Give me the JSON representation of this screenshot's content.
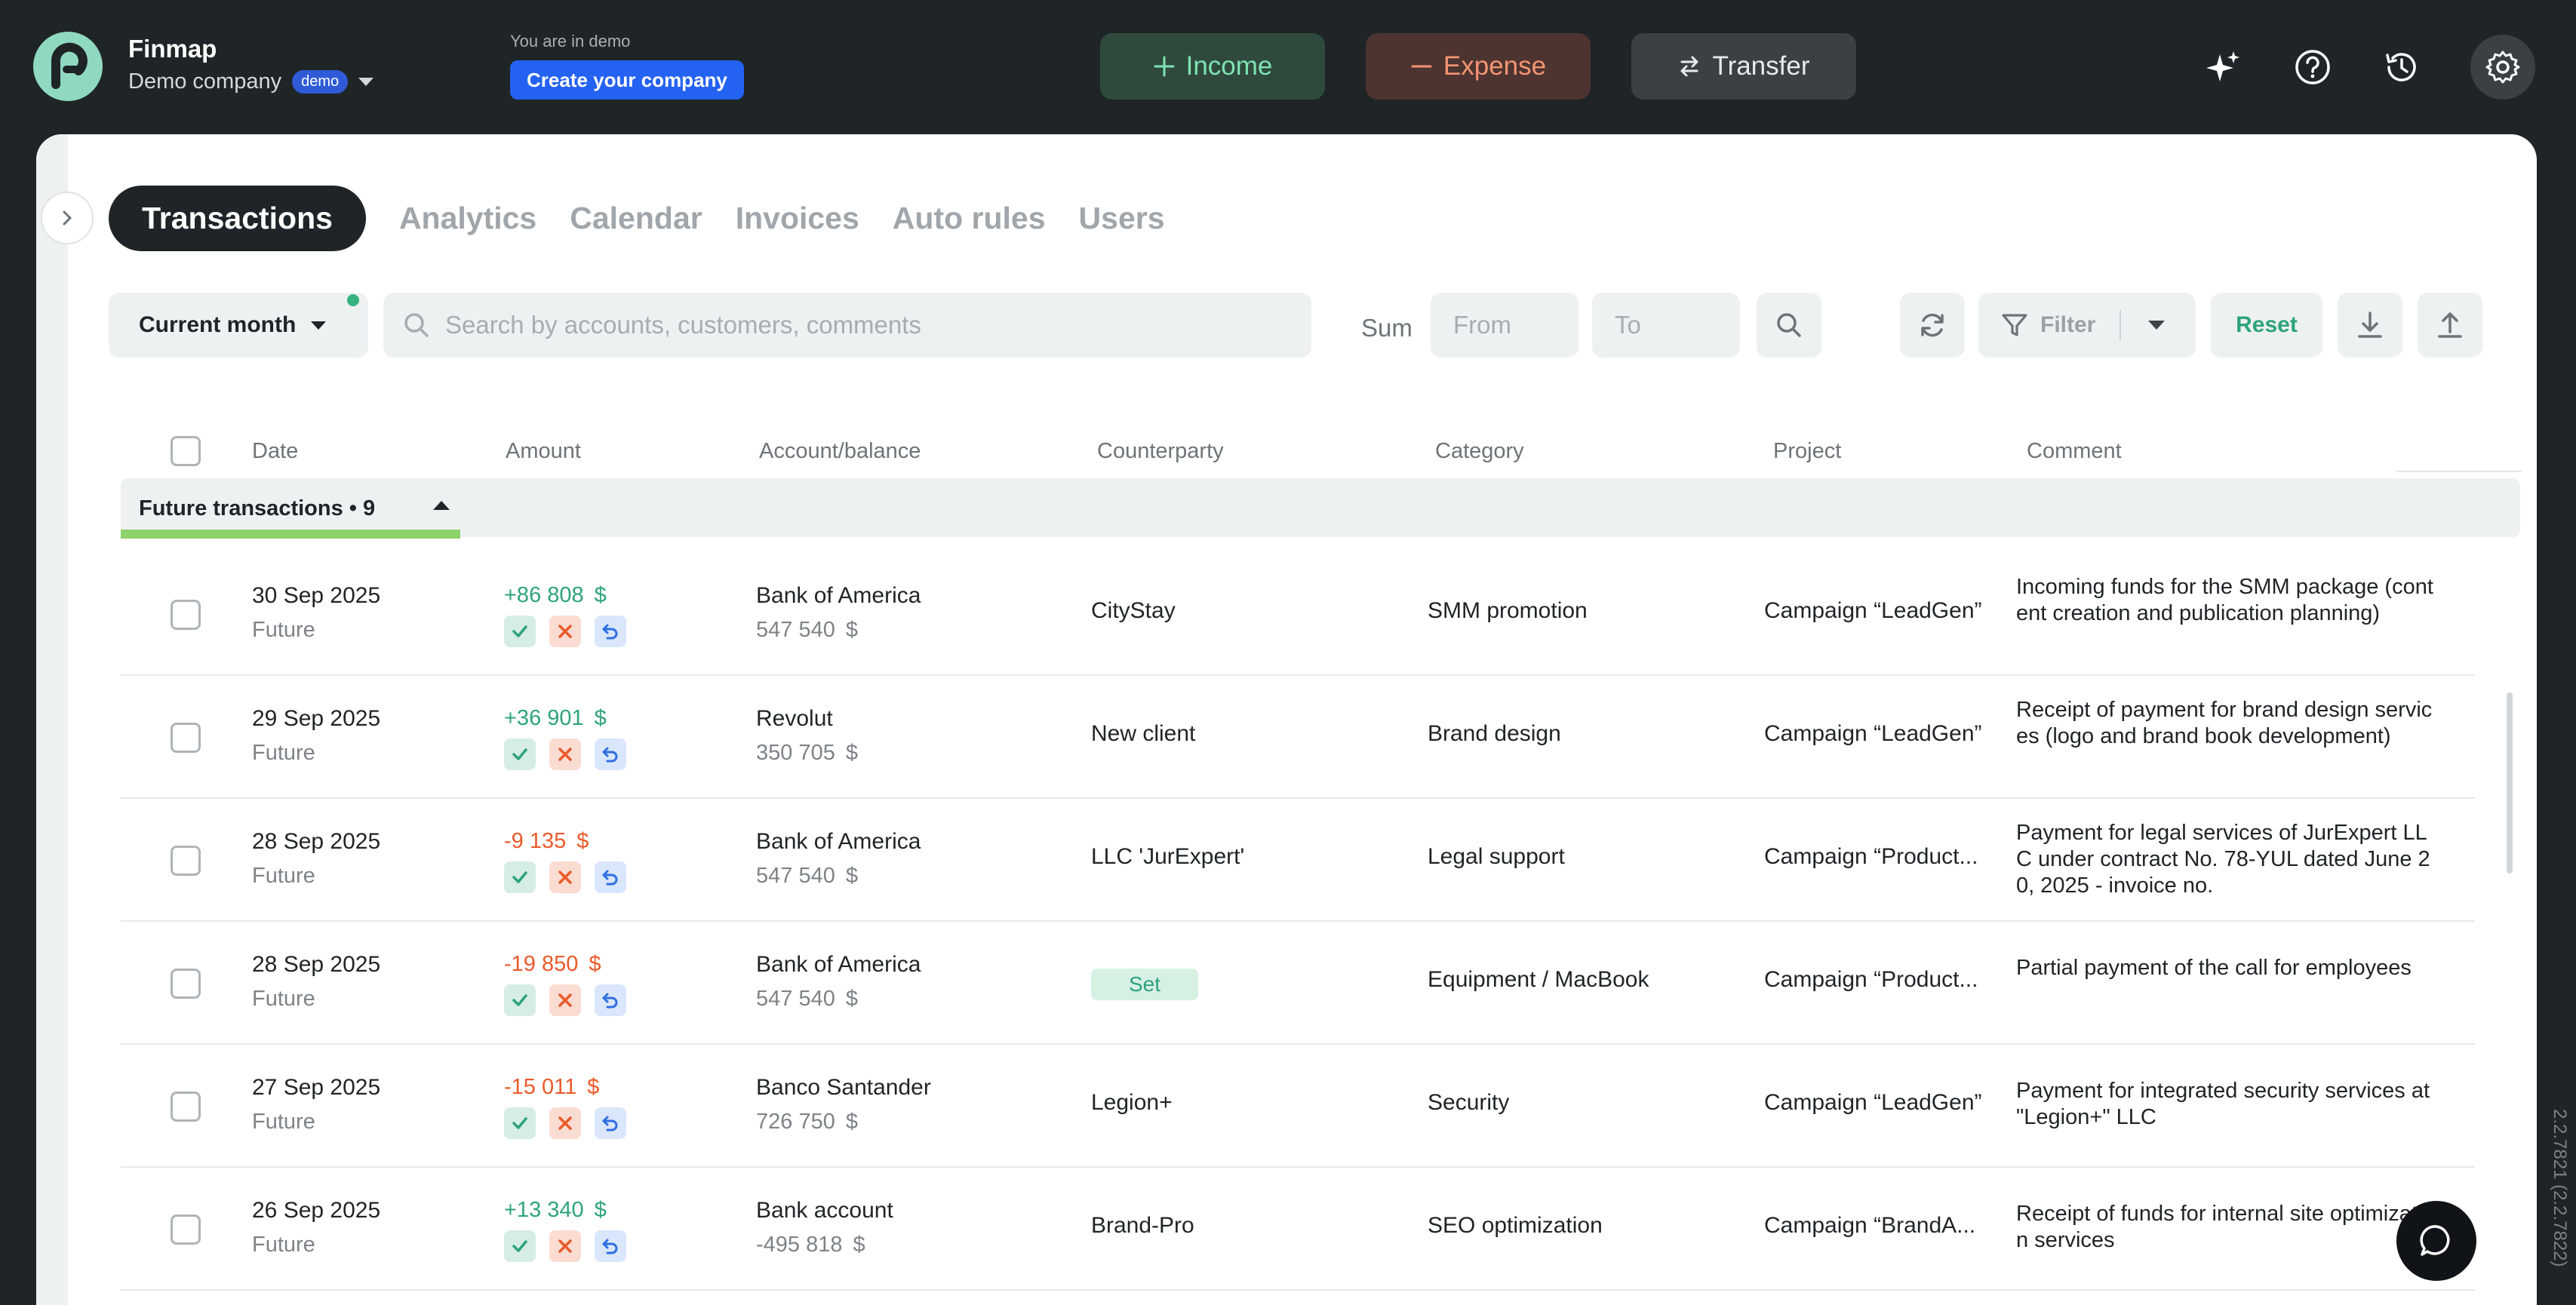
{
  "app": {
    "brand": "Finmap",
    "company": "Demo company",
    "badge": "demo",
    "demo_note": "You are in demo",
    "create_company": "Create your company"
  },
  "top_actions": {
    "income": "Income",
    "expense": "Expense",
    "transfer": "Transfer"
  },
  "top_icons": [
    "sparkles-icon",
    "help-icon",
    "history-icon",
    "settings-icon"
  ],
  "tabs": [
    "Transactions",
    "Analytics",
    "Calendar",
    "Invoices",
    "Auto rules",
    "Users"
  ],
  "filters": {
    "period": "Current month",
    "search_placeholder": "Search by accounts, customers, comments",
    "sum_label": "Sum",
    "from_placeholder": "From",
    "to_placeholder": "To",
    "filter_label": "Filter",
    "reset_label": "Reset"
  },
  "table": {
    "headers": {
      "date": "Date",
      "amount": "Amount",
      "account": "Account/balance",
      "counterparty": "Counterparty",
      "category": "Category",
      "project": "Project",
      "comment": "Comment"
    },
    "group_label": "Future transactions • 9",
    "rows": [
      {
        "date": "30 Sep 2025",
        "status": "Future",
        "amount": "+86 808",
        "currency": "$",
        "account": "Bank of America",
        "balance": "547 540",
        "counterparty": "CityStay",
        "category": "SMM promotion",
        "project": "Campaign “LeadGen”",
        "comment": "Incoming funds for the SMM package (content creation and publication planning)"
      },
      {
        "date": "29 Sep 2025",
        "status": "Future",
        "amount": "+36 901",
        "currency": "$",
        "account": "Revolut",
        "balance": "350 705",
        "counterparty": "New client",
        "category": "Brand design",
        "project": "Campaign “LeadGen”",
        "comment": "Receipt of payment for brand design services (logo and brand book development)"
      },
      {
        "date": "28 Sep 2025",
        "status": "Future",
        "amount": "-9 135",
        "currency": "$",
        "account": "Bank of America",
        "balance": "547 540",
        "counterparty": "LLC 'JurExpert'",
        "category": "Legal support",
        "project": "Campaign “Product...",
        "comment": "Payment for legal services of JurExpert LLC under contract No. 78-YUL dated June 20, 2025 - invoice no."
      },
      {
        "date": "28 Sep 2025",
        "status": "Future",
        "amount": "-19 850",
        "currency": "$",
        "account": "Bank of America",
        "balance": "547 540",
        "counterparty": "Set",
        "category": "Equipment / MacBook",
        "project": "Campaign “Product...",
        "comment": "Partial payment of the call for employees"
      },
      {
        "date": "27 Sep 2025",
        "status": "Future",
        "amount": "-15 011",
        "currency": "$",
        "account": "Banco Santander",
        "balance": "726 750",
        "counterparty": "Legion+",
        "category": "Security",
        "project": "Campaign “LeadGen”",
        "comment": "Payment for integrated security services at \"Legion+\" LLC"
      },
      {
        "date": "26 Sep 2025",
        "status": "Future",
        "amount": "+13 340",
        "currency": "$",
        "account": "Bank account",
        "balance": "-495 818",
        "counterparty": "Brand-Pro",
        "category": "SEO optimization",
        "project": "Campaign “BrandA...",
        "comment": "Receipt of funds for internal site optimization services"
      }
    ]
  },
  "version": "2.2.7821 (2.2.7822)",
  "colors": {
    "positive": "#2ea37a",
    "negative": "#ea5a2b",
    "accent": "#2462f2"
  }
}
